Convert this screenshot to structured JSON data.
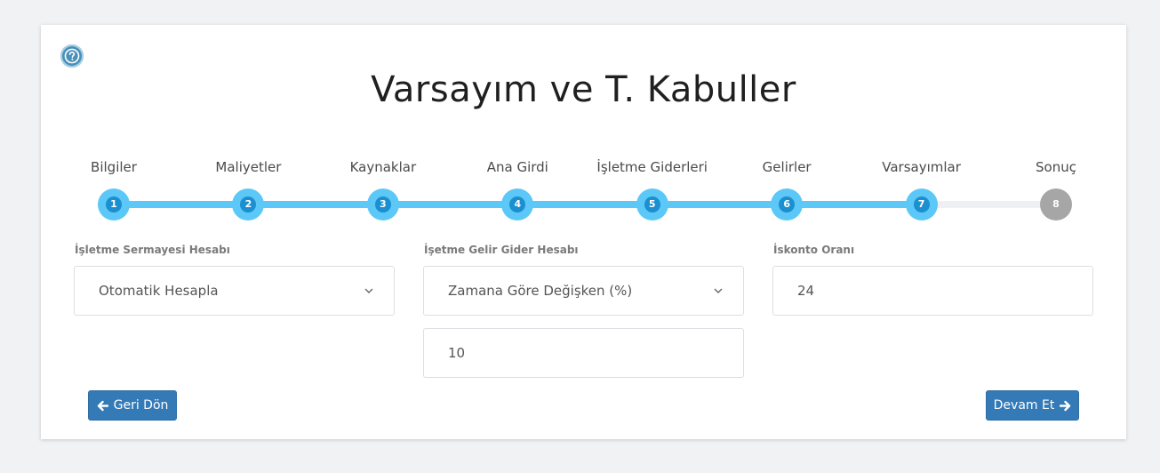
{
  "page": {
    "title": "Varsayım ve T. Kabuller",
    "help_icon": "question-circle-icon"
  },
  "stepper": {
    "steps": [
      {
        "label": "Bilgiler",
        "number": "1",
        "state": "done"
      },
      {
        "label": "Maliyetler",
        "number": "2",
        "state": "done"
      },
      {
        "label": "Kaynaklar",
        "number": "3",
        "state": "done"
      },
      {
        "label": "Ana Girdi",
        "number": "4",
        "state": "done"
      },
      {
        "label": "İşletme Giderleri",
        "number": "5",
        "state": "done"
      },
      {
        "label": "Gelirler",
        "number": "6",
        "state": "done"
      },
      {
        "label": "Varsayımlar",
        "number": "7",
        "state": "done"
      },
      {
        "label": "Sonuç",
        "number": "8",
        "state": "todo"
      }
    ],
    "current_step": 7,
    "total_steps": 8,
    "colors": {
      "active": "#5cc8f7",
      "inactive": "#a6a6a6",
      "track_bg": "#eef0f2"
    }
  },
  "form": {
    "working_capital": {
      "label": "İşletme Sermayesi Hesabı",
      "value": "Otomatik Hesapla"
    },
    "income_expense": {
      "label": "İşetme Gelir Gider Hesabı",
      "value": "Zamana Göre Değişken (%)",
      "rate_value": "10"
    },
    "discount": {
      "label": "İskonto Oranı",
      "value": "24"
    }
  },
  "buttons": {
    "back_label": "Geri Dön",
    "next_label": "Devam Et",
    "color": "#337ab7"
  }
}
